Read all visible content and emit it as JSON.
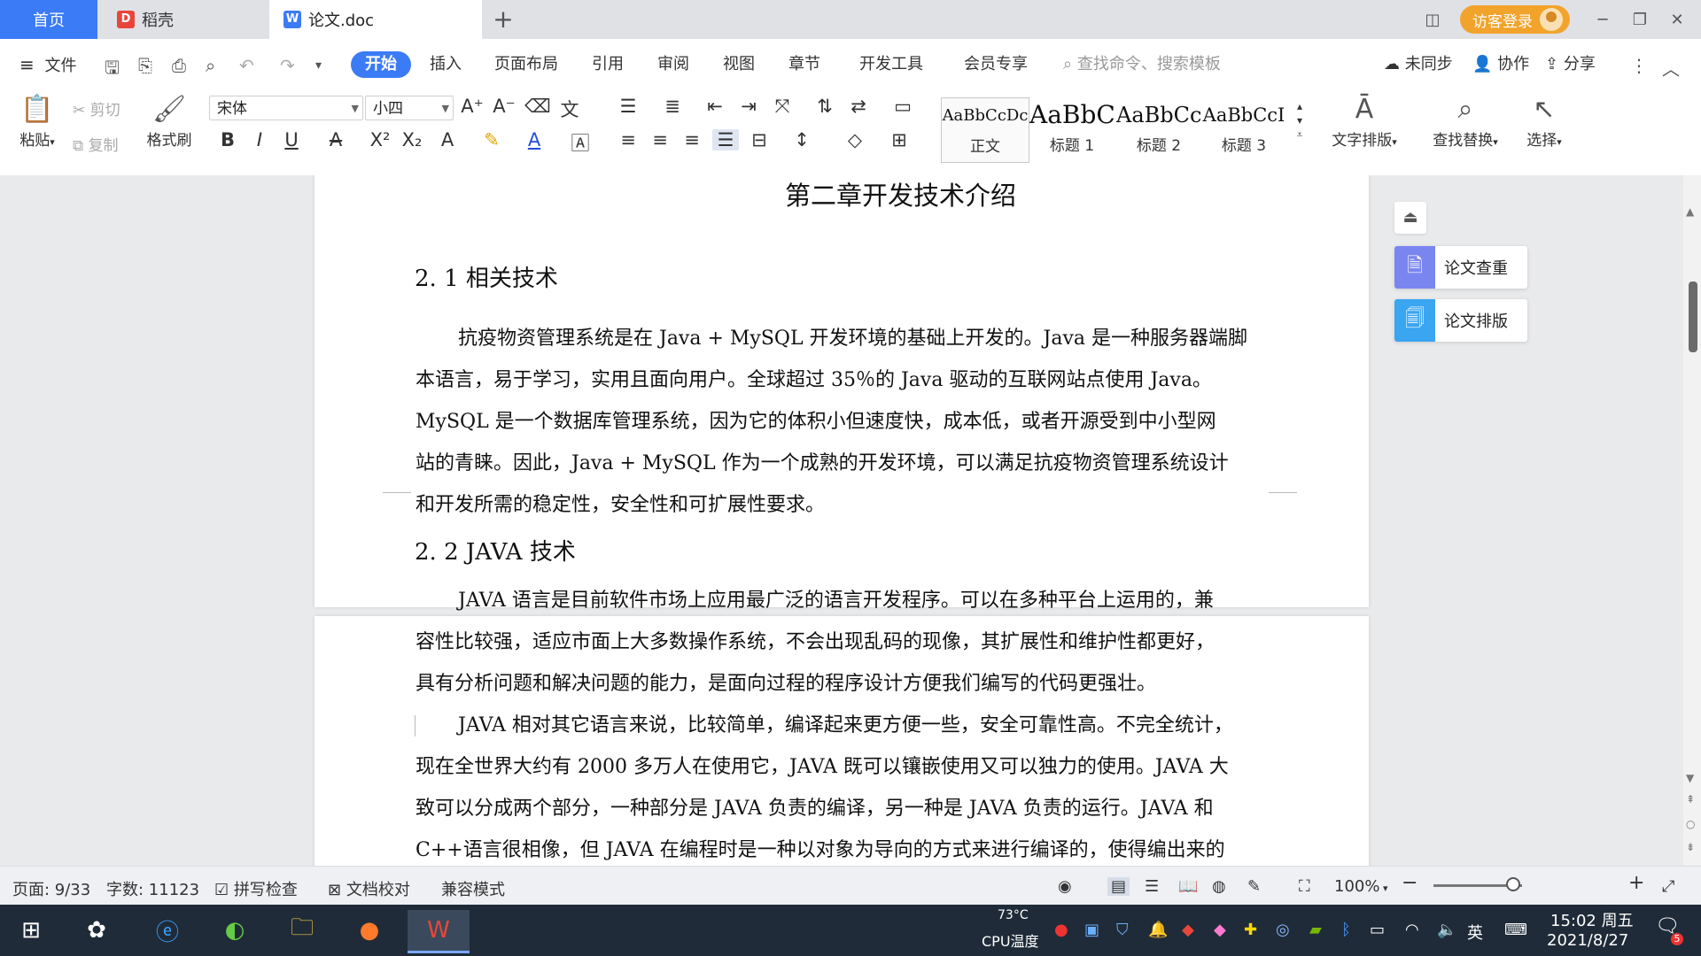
{
  "tabs": {
    "home": "首页",
    "daoke": "稻壳",
    "doc": "论文.doc",
    "new_tab": "+"
  },
  "titlebar": {
    "login": "访客登录"
  },
  "menu": {
    "file": "文件",
    "items": [
      "开始",
      "插入",
      "页面布局",
      "引用",
      "审阅",
      "视图",
      "章节",
      "开发工具",
      "会员专享"
    ],
    "search_placeholder": "查找命令、搜索模板",
    "unsynced": "未同步",
    "collab": "协作",
    "share": "分享"
  },
  "ribbon": {
    "paste": "粘贴",
    "cut": "剪切",
    "copy": "复制",
    "format_painter": "格式刷",
    "font_name": "宋体",
    "font_size": "小四",
    "styles": [
      {
        "sample": "AaBbCcDc",
        "name": "正文"
      },
      {
        "sample": "AaBbC",
        "name": "标题 1"
      },
      {
        "sample": "AaBbCc",
        "name": "标题 2"
      },
      {
        "sample": "AaBbCcI",
        "name": "标题 3"
      }
    ],
    "text_layout": "文字排版",
    "find_replace": "查找替换",
    "select": "选择"
  },
  "document": {
    "chapter_title": "第二章开发技术介绍",
    "h1": "2. 1 相关技术",
    "p1_lines": [
      "抗疫物资管理系统是在 Java + MySQL 开发环境的基础上开发的。Java 是一种服务器端脚",
      "本语言，易于学习，实用且面向用户。全球超过 35％的 Java 驱动的互联网站点使用 Java。",
      "MySQL 是一个数据库管理系统，因为它的体积小但速度快，成本低，或者开源受到中小型网",
      "站的青睐。因此，Java + MySQL 作为一个成熟的开发环境，可以满足抗疫物资管理系统设计",
      "和开发所需的稳定性，安全性和可扩展性要求。"
    ],
    "h2": "2. 2  JAVA 技术",
    "p2_lines": [
      "JAVA 语言是目前软件市场上应用最广泛的语言开发程序。可以在多种平台上运用的，兼",
      "容性比较强，适应市面上大多数操作系统，不会出现乱码的现像，其扩展性和维护性都更好，",
      "具有分析问题和解决问题的能力，是面向过程的程序设计方便我们编写的代码更强壮。"
    ],
    "p3_lines": [
      "JAVA 相对其它语言来说，比较简单，编译起来更方便一些，安全可靠性高。不完全统计，",
      "现在全世界大约有 2000 多万人在使用它，JAVA 既可以镶嵌使用又可以独力的使用。JAVA 大",
      "致可以分成两个部分，一种部分是 JAVA 负责的编译，另一种是 JAVA 负责的运行。JAVA 和",
      "C++语言很相像，但 JAVA 在编程时是一种以对象为导向的方式来进行编译的，使得编出来的"
    ]
  },
  "side_panel": {
    "check": "论文查重",
    "layout": "论文排版"
  },
  "status": {
    "page": "页面: 9/33",
    "words": "字数: 11123",
    "spell": "拼写检查",
    "proof": "文档校对",
    "compat": "兼容模式",
    "zoom": "100%",
    "zoom_level": 0.9
  },
  "taskbar": {
    "temp": "73°C",
    "cpu": "CPU温度",
    "ime": "英",
    "time": "15:02 周五",
    "date": "2021/8/27",
    "notif_count": "5"
  },
  "colors": {
    "accent": "#3b7bf6",
    "login": "#f2a32c",
    "taskbar": "#1f2b38",
    "check_icon": "#7a86f0",
    "layout_icon": "#3aa5f0"
  }
}
